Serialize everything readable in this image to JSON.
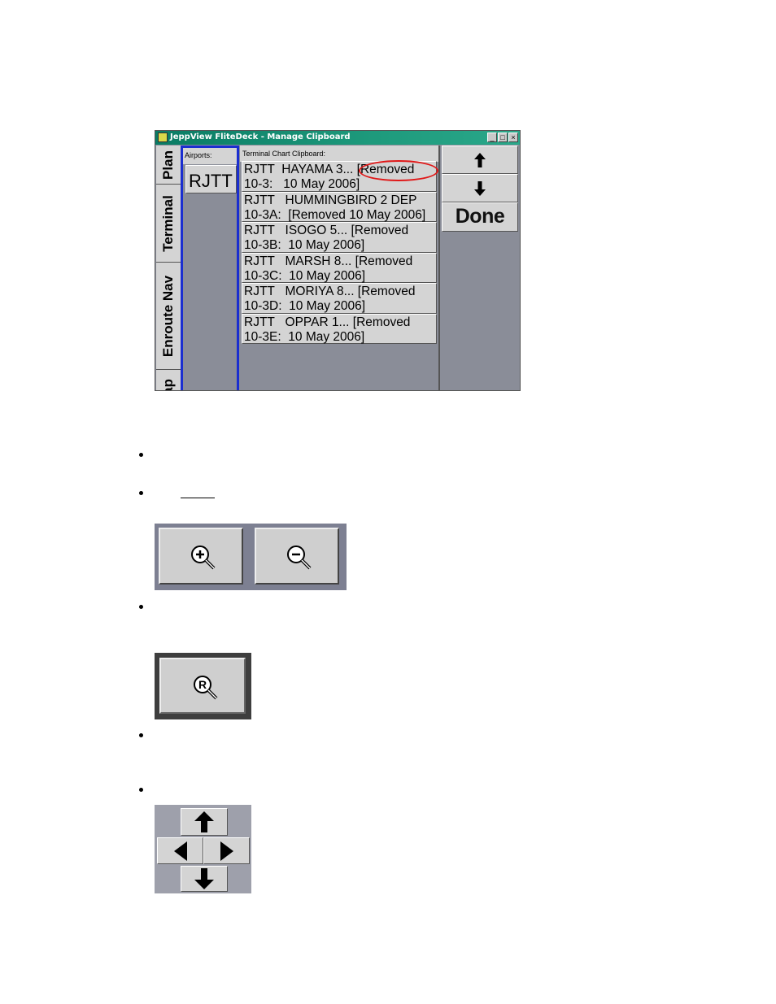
{
  "window": {
    "title": "JeppView FliteDeck - Manage Clipboard",
    "controls": [
      "_",
      "□",
      "×"
    ]
  },
  "tabs": [
    {
      "label": "Plan"
    },
    {
      "label": "Terminal"
    },
    {
      "label": "Enroute Nav"
    },
    {
      "label": "Map"
    }
  ],
  "airports": {
    "header": "Airports:",
    "items": [
      "RJTT"
    ]
  },
  "clipboard": {
    "header": "Terminal Chart Clipboard:",
    "rows": [
      {
        "line1": "RJTT  HAYAMA 3... [Removed",
        "line2": "10-3:   10 May 2006]",
        "highlighted": true
      },
      {
        "line1": "RJTT   HUMMINGBIRD 2 DEP",
        "line2": "10-3A:  [Removed 10 May 2006]"
      },
      {
        "line1": "RJTT   ISOGO 5... [Removed",
        "line2": "10-3B:  10 May 2006]"
      },
      {
        "line1": "RJTT   MARSH 8... [Removed",
        "line2": "10-3C:  10 May 2006]"
      },
      {
        "line1": "RJTT   MORIYA 8... [Removed",
        "line2": "10-3D:  10 May 2006]"
      },
      {
        "line1": "RJTT   OPPAR 1... [Removed",
        "line2": "10-3E:  10 May 2006]"
      }
    ]
  },
  "right_buttons": {
    "up_icon": "arrow-up-icon",
    "down_icon": "arrow-down-icon",
    "done_label": "Done"
  },
  "zoom": {
    "zoom_in_icon": "zoom-in-icon",
    "zoom_out_icon": "zoom-out-icon"
  },
  "reset_zoom": {
    "icon": "zoom-reset-icon",
    "icon_letter": "R"
  },
  "pan": {
    "icons": [
      "pan-up-icon",
      "pan-left-icon",
      "pan-right-icon",
      "pan-down-icon"
    ]
  },
  "colors": {
    "titlebar": "#0a7b64",
    "panel_gray": "#8a8d98",
    "button_face": "#d4d4d4",
    "airports_border": "#1a2ed0",
    "highlight_oval": "#e01818"
  }
}
